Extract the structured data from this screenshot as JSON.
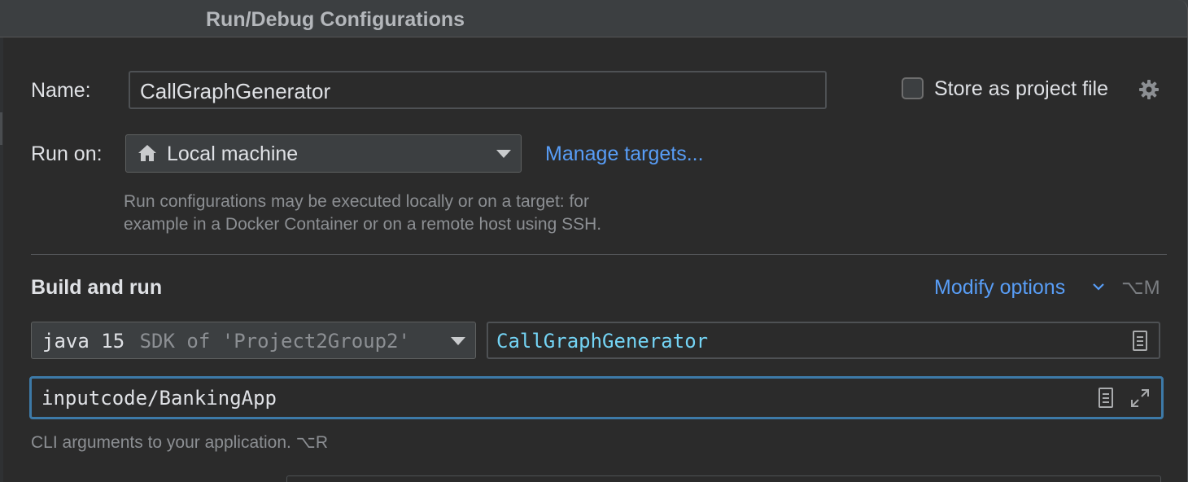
{
  "window": {
    "title": "Run/Debug Configurations"
  },
  "name_row": {
    "label": "Name:",
    "value": "CallGraphGenerator",
    "store_label": "Store as project file",
    "store_checked": false
  },
  "run_on": {
    "label": "Run on:",
    "selected": "Local machine",
    "icon": "home-icon",
    "manage_link": "Manage targets...",
    "hint_line1": "Run configurations may be executed locally or on a target: for",
    "hint_line2": "example in a Docker Container or on a remote host using SSH."
  },
  "build": {
    "heading": "Build and run",
    "modify_label": "Modify options",
    "modify_shortcut": "⌥M",
    "sdk_name": "java 15",
    "sdk_detail": "SDK of 'Project2Group2'",
    "main_class": "CallGraphGenerator",
    "args_value": "inputcode/BankingApp",
    "args_hint": "CLI arguments to your application. ⌥R"
  },
  "colors": {
    "background": "#2b2b2b",
    "link": "#589df6",
    "focus": "#3d7aa8",
    "class_name": "#74d4f5"
  }
}
